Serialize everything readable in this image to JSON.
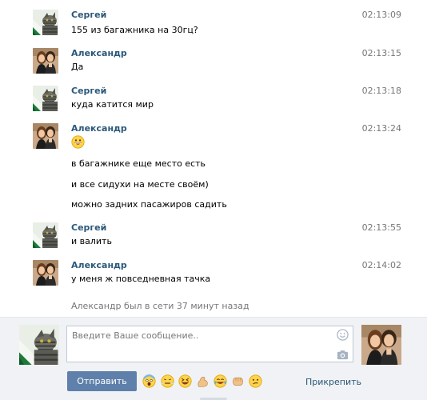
{
  "messages": [
    {
      "author": "Сергей",
      "avatar": "cat-avatar",
      "time": "02:13:09",
      "lines": [
        "155 из багажника на 30гц?"
      ]
    },
    {
      "author": "Александр",
      "avatar": "couple-avatar",
      "time": "02:13:15",
      "lines": [
        "Да"
      ]
    },
    {
      "author": "Сергей",
      "avatar": "cat-avatar",
      "time": "02:13:18",
      "lines": [
        "куда катится мир"
      ]
    },
    {
      "author": "Александр",
      "avatar": "couple-avatar",
      "time": "02:13:24",
      "emoji": "grinning-smiley-icon",
      "lines": [
        "в багажнике еще место есть",
        "и все сидухи на месте своём)",
        "можно задних пасажиров садить"
      ]
    },
    {
      "author": "Сергей",
      "avatar": "cat-avatar",
      "time": "02:13:55",
      "lines": [
        "и валить"
      ]
    },
    {
      "author": "Александр",
      "avatar": "couple-avatar",
      "time": "02:14:02",
      "lines": [
        "у меня ж повседневная тачка"
      ]
    }
  ],
  "status_text": "Александр был в сети 37 минут назад",
  "composer": {
    "placeholder": "Введите Ваше сообщение..",
    "send_label": "Отправить",
    "attach_label": "Прикрепить",
    "emoji_icon": "smiley-picker-icon",
    "camera_icon": "camera-icon",
    "quick_emojis": [
      "fearful-face-icon",
      "steam-face-icon",
      "squinting-laugh-icon",
      "flexed-biceps-icon",
      "tears-of-joy-icon",
      "fist-bump-icon",
      "confused-face-icon"
    ]
  },
  "colors": {
    "link": "#2b587a",
    "send_button": "#5e80aa",
    "composer_bg": "#f0f2f5",
    "muted_text": "#777777"
  }
}
